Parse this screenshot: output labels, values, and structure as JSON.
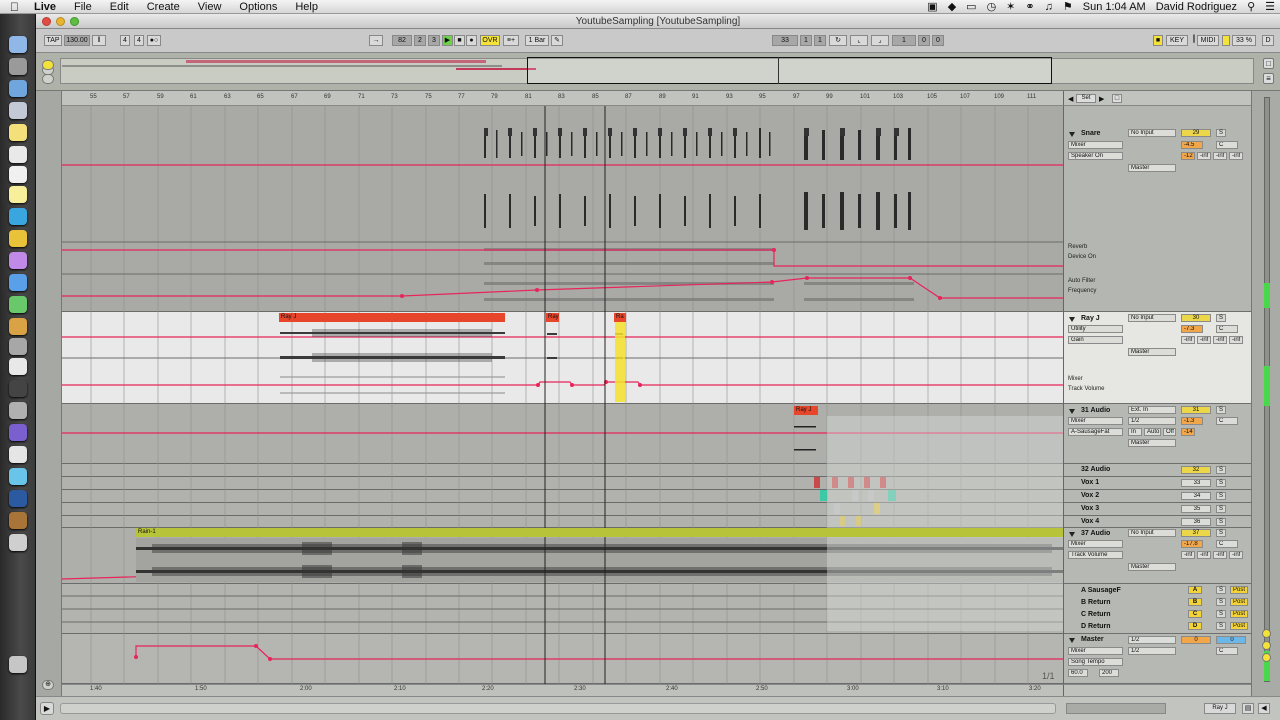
{
  "menubar": {
    "app_name": "Live",
    "items": [
      "File",
      "Edit",
      "Create",
      "View",
      "Options",
      "Help"
    ],
    "clock": "Sun 1:04 AM",
    "user": "David Rodriguez"
  },
  "window": {
    "title": "YoutubeSampling  [YoutubeSampling]"
  },
  "transport": {
    "tap": "TAP",
    "tempo": "130.00",
    "time_sig_num": "4",
    "time_sig_den": "4",
    "pos_bar": "82",
    "pos_beat": "2",
    "pos_sixteenth": "3",
    "ovr": "OVR",
    "quantize": "1 Bar",
    "loop_start_bar": "33",
    "loop_start_beat": "1",
    "loop_start_sixteenth": "1",
    "loop_len_bar": "1",
    "loop_len_beat": "0",
    "loop_len_sixteenth": "0",
    "key": "KEY",
    "midi": "MIDI",
    "cpu": "33 %",
    "d_label": "D"
  },
  "ruler": {
    "bars": [
      "55",
      "57",
      "59",
      "61",
      "63",
      "65",
      "67",
      "69",
      "71",
      "73",
      "75",
      "77",
      "79",
      "81",
      "83",
      "85",
      "87",
      "89",
      "91",
      "93",
      "95",
      "97",
      "99",
      "101",
      "103",
      "105",
      "107",
      "109",
      "111"
    ],
    "set_label": "Set"
  },
  "timeline": {
    "times": [
      "1:40",
      "1:50",
      "2:00",
      "2:10",
      "2:20",
      "2:30",
      "2:40",
      "2:50",
      "3:00",
      "3:10",
      "3:20"
    ],
    "page": "1/1"
  },
  "tracks": {
    "snare": {
      "name": "Snare",
      "input": "No Input",
      "number": "29",
      "solo": "S",
      "volume": "-4.5",
      "pan": "C",
      "meter_a": "-12",
      "meter_b": "-inf",
      "meter_c": "-inf",
      "meter_d": "-inf",
      "device": "Mixer",
      "param": "Speaker On",
      "output": "Master",
      "lane1_device": "Reverb",
      "lane1_param": "Device On",
      "lane2_device": "Auto Filter",
      "lane2_param": "Frequency"
    },
    "rayj": {
      "name": "Ray J",
      "input": "No Input",
      "number": "30",
      "solo": "S",
      "volume": "-7.3",
      "pan": "C",
      "meter_a": "-inf",
      "meter_b": "-inf",
      "meter_c": "-inf",
      "meter_d": "-inf",
      "device": "Utility",
      "param": "Gain",
      "output": "Master",
      "lane1_device": "Mixer",
      "lane1_param": "Track Volume",
      "clip_main": "Ray J",
      "clip_small1": "Ray",
      "clip_small2": "Ra"
    },
    "audio31": {
      "name": "31 Audio",
      "input": "Ext. In",
      "input_ch": "1/2",
      "number": "31",
      "solo": "S",
      "volume": "-1.3",
      "pan": "C",
      "meter_a": "-14",
      "device": "Mixer",
      "param": "A-SausageFat",
      "monitor_in": "In",
      "monitor_auto": "Auto",
      "monitor_off": "Off",
      "output": "Master",
      "clip": "Ray J"
    },
    "audio32": {
      "name": "32 Audio",
      "number": "32",
      "solo": "S"
    },
    "vox1": {
      "name": "Vox 1",
      "number": "33",
      "solo": "S"
    },
    "vox2": {
      "name": "Vox 2",
      "number": "34",
      "solo": "S"
    },
    "vox3": {
      "name": "Vox 3",
      "number": "35",
      "solo": "S"
    },
    "vox4": {
      "name": "Vox 4",
      "number": "36",
      "solo": "S"
    },
    "audio37": {
      "name": "37 Audio",
      "input": "No Input",
      "number": "37",
      "solo": "S",
      "volume": "-17.8",
      "pan": "C",
      "meter_a": "-inf",
      "meter_b": "-inf",
      "meter_c": "-inf",
      "meter_d": "-inf",
      "device": "Mixer",
      "param": "Track Volume",
      "output": "Master",
      "clip": "Rain-1"
    }
  },
  "returns": [
    {
      "name": "A SausageF",
      "letter": "A",
      "solo": "S",
      "post": "Post"
    },
    {
      "name": "B Return",
      "letter": "B",
      "solo": "S",
      "post": "Post"
    },
    {
      "name": "C Return",
      "letter": "C",
      "solo": "S",
      "post": "Post"
    },
    {
      "name": "D Return",
      "letter": "D",
      "solo": "S",
      "post": "Post"
    }
  ],
  "master": {
    "name": "Master",
    "cue": "1/2",
    "out": "1/2",
    "number": "0",
    "volume": "0",
    "pan": "C",
    "device": "Mixer",
    "param": "Song Tempo",
    "range_min": "60.0",
    "range_max": "200"
  },
  "status": {
    "clip_name": "Ray J"
  },
  "colors": {
    "automation": "#e8245a",
    "clip_orange": "#e8462a",
    "clip_yellow": "#f4e22c",
    "clip_green": "#b7c43a",
    "track_number": "#ecd64a",
    "meter_green": "#48d84a"
  }
}
